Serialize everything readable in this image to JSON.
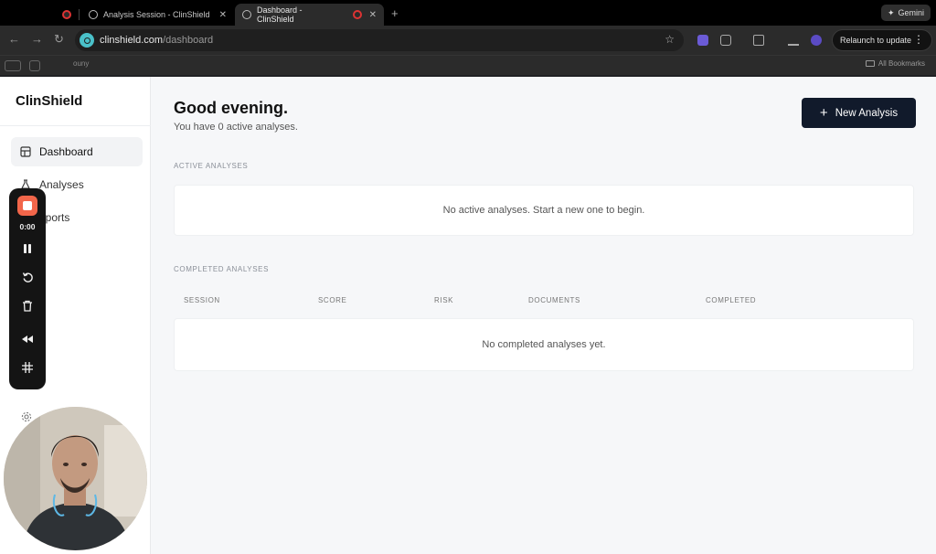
{
  "browser": {
    "tabs": [
      {
        "title": "",
        "kind": "recording"
      },
      {
        "title": "Analysis Session - ClinShield",
        "kind": "page"
      },
      {
        "title": "Dashboard - ClinShield",
        "kind": "page",
        "active": true
      }
    ],
    "gemini_label": "Gemini",
    "url_host": "clinshield.com",
    "url_path": "/dashboard",
    "relaunch_label": "Relaunch to update",
    "bookmark_partial": "ouny",
    "all_bookmarks_label": "All Bookmarks"
  },
  "app": {
    "brand": "ClinShield",
    "nav": [
      {
        "label": "Dashboard",
        "active": true
      },
      {
        "label": "Analyses"
      },
      {
        "label": "eports"
      }
    ],
    "greeting": "Good evening.",
    "subtitle": "You have 0 active analyses.",
    "new_button": "New Analysis",
    "active_label": "ACTIVE ANALYSES",
    "active_empty": "No active analyses. Start a new one to begin.",
    "completed_label": "COMPLETED ANALYSES",
    "columns": [
      "SESSION",
      "SCORE",
      "RISK",
      "DOCUMENTS",
      "COMPLETED"
    ],
    "completed_empty": "No completed analyses yet."
  },
  "recorder": {
    "time": "0:00",
    "controls": [
      "stop",
      "pause",
      "restart",
      "delete",
      "rewind",
      "grid"
    ]
  },
  "colors": {
    "primary_button": "#111a2b",
    "record_stop": "#f2664a",
    "site_icon": "#4ac1c9"
  }
}
